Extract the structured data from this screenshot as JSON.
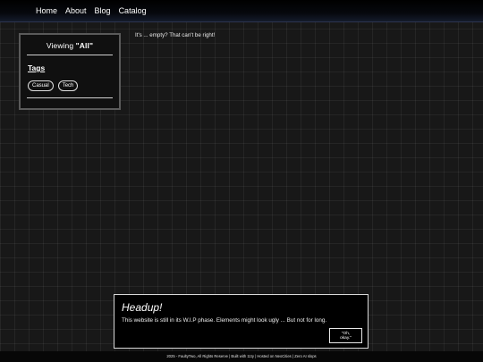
{
  "nav": {
    "items": [
      "Home",
      "About",
      "Blog",
      "Catalog"
    ]
  },
  "sidebar": {
    "viewing_prefix": "Viewing ",
    "viewing_value": "\"All\"",
    "tags_title": "Tags",
    "tags": [
      "Casual",
      "Tech"
    ]
  },
  "main": {
    "empty_message": "It's ... empty? That can't be right!"
  },
  "notice": {
    "title": "Headup!",
    "text": "This website is still in its W.I.P phase. Elements might look ugly ... But not for long.",
    "button_label": "\"Oh, okay.\""
  },
  "footer": {
    "part1": "2025 - FaultyTwo, All Rights Reserve | Built with ",
    "link1": "11ty",
    "part2": " | Hosted on ",
    "link2": "NeoCities",
    "part3": " | Zero AI slops"
  }
}
